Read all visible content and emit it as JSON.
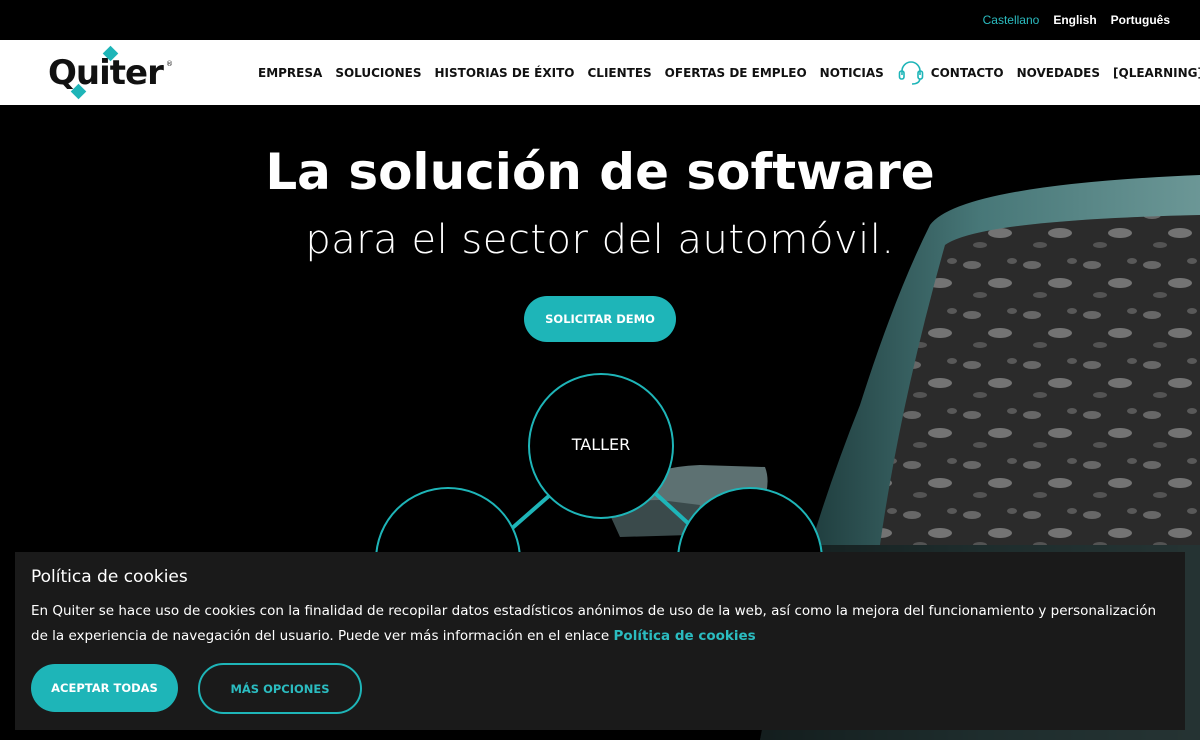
{
  "languages": [
    {
      "label": "Castellano",
      "active": true
    },
    {
      "label": "English",
      "active": false
    },
    {
      "label": "Português",
      "active": false
    }
  ],
  "brand": {
    "name": "Quiter",
    "registered": "®",
    "accent": "#1eb5b8"
  },
  "nav": {
    "items": [
      "EMPRESA",
      "SOLUCIONES",
      "HISTORIAS DE ÉXITO",
      "CLIENTES",
      "OFERTAS DE EMPLEO",
      "NOTICIAS"
    ],
    "contact": "CONTACTO",
    "contact_icon": "headset-icon",
    "after": [
      "NOVEDADES",
      "[QLEARNING]"
    ]
  },
  "hero": {
    "title": "La solución de software",
    "subtitle": "para el sector del automóvil.",
    "cta": "SOLICITAR DEMO",
    "circle_label": "TALLER"
  },
  "cookie": {
    "title": "Política de cookies",
    "text": "En Quiter se hace uso de cookies con la finalidad de recopilar datos estadísticos anónimos de uso de la web, así como la mejora del funcionamiento y personalización de la experiencia de navegación del usuario. Puede ver más información en el enlace ",
    "link": "Política de cookies",
    "accept": "ACEPTAR TODAS",
    "more": "MÁS OPCIONES"
  }
}
